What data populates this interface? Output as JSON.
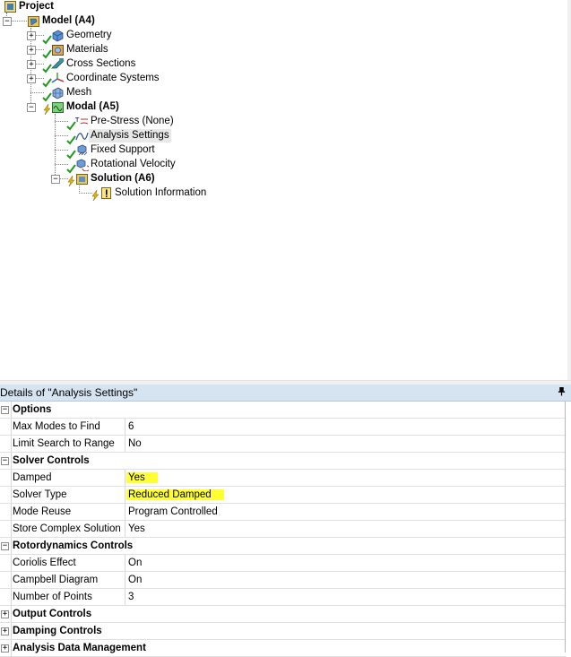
{
  "tree": {
    "project": "Project",
    "model": "Model (A4)",
    "geometry": "Geometry",
    "materials": "Materials",
    "cross_sections": "Cross Sections",
    "coordinate_systems": "Coordinate Systems",
    "mesh": "Mesh",
    "modal": "Modal (A5)",
    "pre_stress": "Pre-Stress (None)",
    "analysis_settings": "Analysis Settings",
    "fixed_support": "Fixed Support",
    "rotational_velocity": "Rotational Velocity",
    "solution": "Solution (A6)",
    "solution_information": "Solution Information"
  },
  "details": {
    "title": "Details of \"Analysis Settings\"",
    "pin_icon": "pin-icon",
    "rows": [
      {
        "type": "group",
        "expander": "−",
        "label": "Options"
      },
      {
        "type": "prop",
        "label": "Max Modes to Find",
        "value": "6"
      },
      {
        "type": "prop",
        "label": "Limit Search to Range",
        "value": "No"
      },
      {
        "type": "group",
        "expander": "−",
        "label": "Solver Controls"
      },
      {
        "type": "prop",
        "label": "Damped",
        "value": "Yes",
        "highlight": true
      },
      {
        "type": "prop",
        "label": "Solver Type",
        "value": "Reduced Damped",
        "highlight": true
      },
      {
        "type": "prop",
        "label": "Mode Reuse",
        "value": "Program Controlled"
      },
      {
        "type": "prop",
        "label": "Store Complex Solution",
        "value": "Yes"
      },
      {
        "type": "group",
        "expander": "−",
        "label": "Rotordynamics Controls"
      },
      {
        "type": "prop",
        "label": "Coriolis Effect",
        "value": "On"
      },
      {
        "type": "prop",
        "label": "Campbell Diagram",
        "value": "On"
      },
      {
        "type": "prop",
        "label": "Number of Points",
        "value": "3"
      },
      {
        "type": "group",
        "expander": "+",
        "label": "Output Controls"
      },
      {
        "type": "group",
        "expander": "+",
        "label": "Damping Controls"
      },
      {
        "type": "group",
        "expander": "+",
        "label": "Analysis Data Management"
      }
    ]
  },
  "colors": {
    "highlight": "#ffff33",
    "header_bg": "#d6e3f0",
    "check_green": "#1e9a1e"
  }
}
